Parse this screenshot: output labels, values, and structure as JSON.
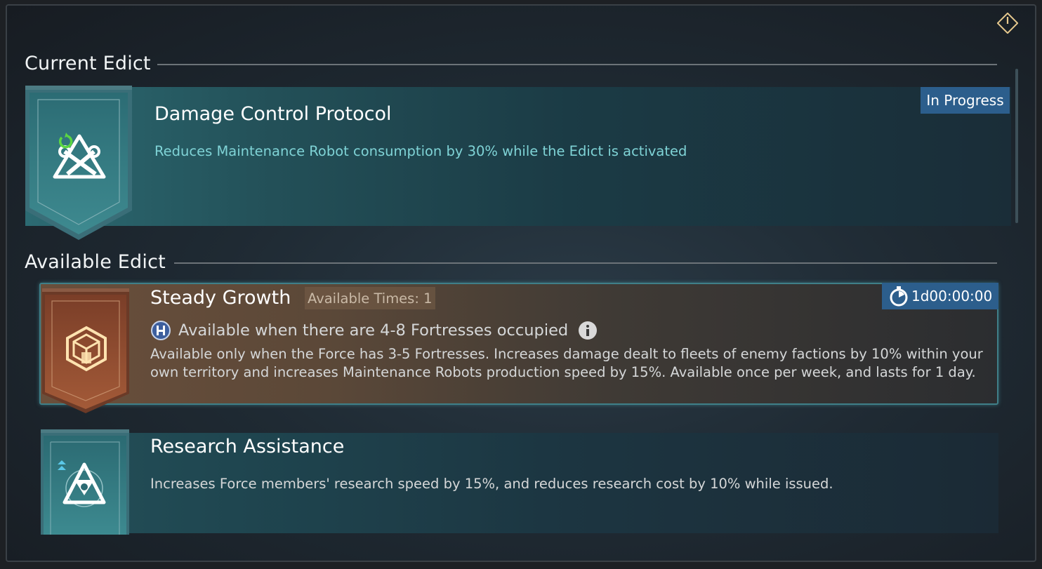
{
  "close_button": {
    "icon": "power-diamond-icon"
  },
  "current_section": {
    "title": "Current Edict"
  },
  "current_edict": {
    "name": "Damage Control Protocol",
    "description": "Reduces Maintenance Robot consumption by 30% while the Edict is activated",
    "status": "In Progress",
    "icon": "repair-tools-triangle-icon",
    "accent_color": "#2d6b73"
  },
  "available_section": {
    "title": "Available Edict"
  },
  "available_edicts": [
    {
      "name": "Steady Growth",
      "available_times": "Available Times: 1",
      "condition": "Available when there are 4-8 Fortresses occupied",
      "description": "Available only when the Force has 3-5 Fortresses. Increases damage dealt to fleets of enemy factions by 10% within your own territory and increases Maintenance Robots production speed by 15%. Available once per week, and lasts for 1 day.",
      "timer": "1d00:00:00",
      "icon": "fortress-cube-icon",
      "accent_color": "#7a4a30"
    },
    {
      "name": "Research Assistance",
      "description": "Increases Force members' research speed by 15%, and reduces research cost by 10% while issued.",
      "icon": "research-triangle-icon",
      "accent_color": "#2d6b73"
    }
  ],
  "colors": {
    "desc_teal": "#7fd3d6",
    "desc_light": "#d5d7d8",
    "badge_blue": "#2c5e8c"
  }
}
